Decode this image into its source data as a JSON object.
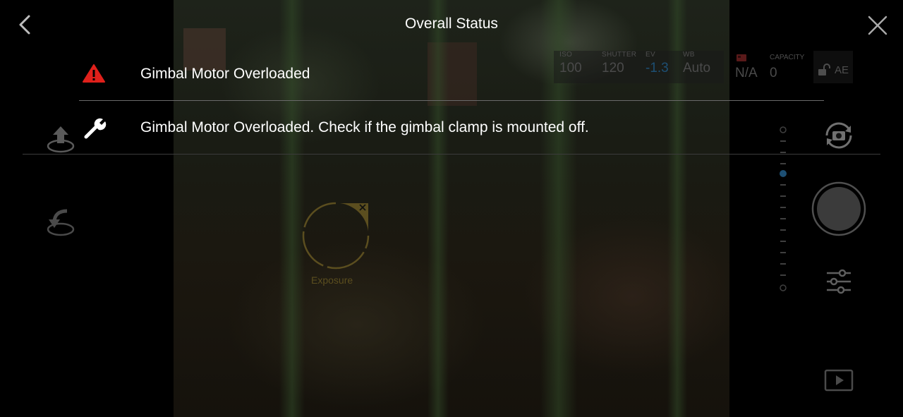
{
  "header": {
    "title": "Overall Status"
  },
  "camera_bar": {
    "iso": {
      "label": "ISO",
      "value": "100"
    },
    "shutter": {
      "label": "SHUTTER",
      "value": "120"
    },
    "ev": {
      "label": "EV",
      "value": "-1.3"
    },
    "wb": {
      "label": "WB",
      "value": "Auto"
    },
    "storage": {
      "value": "N/A"
    },
    "capacity": {
      "label": "CAPACITY",
      "value": "0"
    },
    "ae_lock": {
      "label": "AE"
    }
  },
  "status": {
    "rows": [
      {
        "icon": "warning-icon",
        "text": "Gimbal Motor Overloaded"
      },
      {
        "icon": "wrench-icon",
        "text": "Gimbal Motor Overloaded. Check if the gimbal clamp is mounted off."
      }
    ]
  },
  "exposure": {
    "label": "Exposure"
  },
  "colors": {
    "warning": "#e0201b",
    "exposure_accent": "#5b4e1f",
    "ev_value": "#1d4f73"
  }
}
